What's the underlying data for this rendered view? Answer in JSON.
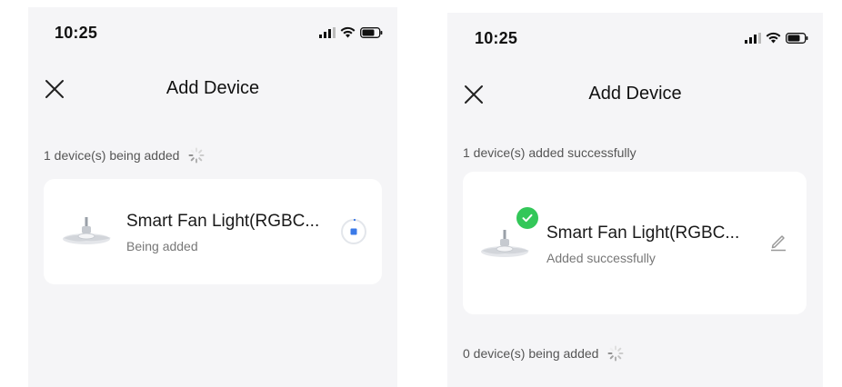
{
  "status_bar": {
    "time": "10:25"
  },
  "nav": {
    "title": "Add Device"
  },
  "left_screen": {
    "section_label": "1 device(s) being added",
    "device": {
      "name": "Smart Fan Light(RGBC...",
      "status": "Being added"
    }
  },
  "right_screen": {
    "section_label": "1 device(s) added successfully",
    "device": {
      "name": "Smart Fan Light(RGBC...",
      "status": "Added successfully"
    },
    "pending_label": "0 device(s) being added"
  },
  "colors": {
    "success": "#33c759",
    "progress": "#3b7ae8",
    "background": "#f5f5f7",
    "card": "#ffffff"
  },
  "icons": [
    "close-icon",
    "signal-icon",
    "wifi-icon",
    "battery-icon",
    "spinner-icon",
    "check-icon",
    "edit-icon",
    "progress-icon"
  ]
}
